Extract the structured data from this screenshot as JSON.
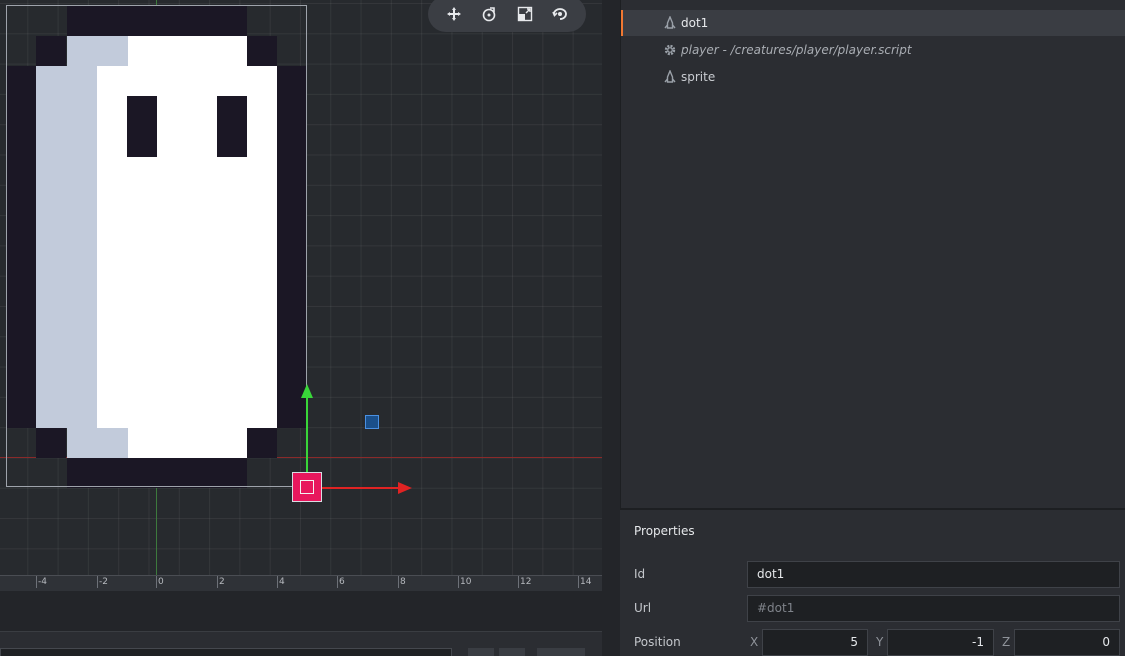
{
  "toolbar": {
    "tools": [
      {
        "name": "move-tool",
        "icon": "move-icon"
      },
      {
        "name": "rotate-tool",
        "icon": "rotate-icon"
      },
      {
        "name": "scale-tool",
        "icon": "scale-icon"
      },
      {
        "name": "perspective-tool",
        "icon": "camera-icon"
      }
    ]
  },
  "ruler": {
    "labels": [
      "-4",
      "-2",
      "0",
      "2",
      "4",
      "6",
      "8",
      "10",
      "12",
      "14"
    ]
  },
  "outline": {
    "items": [
      {
        "label": "dot1",
        "icon": "sprite-icon",
        "selected": true
      },
      {
        "label": "player - /creatures/player/player.script",
        "icon": "gear-icon",
        "italic": true
      },
      {
        "label": "sprite",
        "icon": "sprite-icon"
      }
    ]
  },
  "properties": {
    "title": "Properties",
    "id_label": "Id",
    "id_value": "dot1",
    "url_label": "Url",
    "url_value": "#dot1",
    "position_label": "Position",
    "x_label": "X",
    "y_label": "Y",
    "z_label": "Z",
    "x_value": "5",
    "y_value": "-1",
    "z_value": "0"
  },
  "colors": {
    "accent": "#f07832",
    "gizmo_x": "#e02323",
    "gizmo_y": "#39d639",
    "gizmo_center": "#e8175d"
  }
}
